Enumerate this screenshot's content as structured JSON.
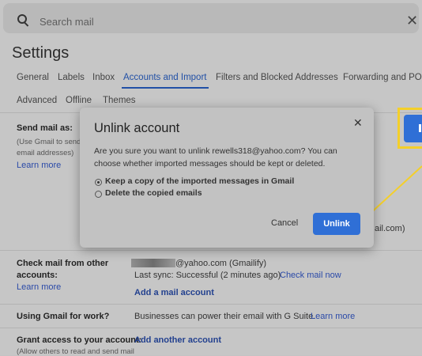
{
  "search": {
    "placeholder": "Search mail",
    "close_glyph": "✕"
  },
  "settings": {
    "title": "Settings",
    "tabs_row1": [
      "General",
      "Labels",
      "Inbox",
      "Accounts and Import",
      "Filters and Blocked Addresses",
      "Forwarding and POP"
    ],
    "tabs_row2": [
      "Advanced",
      "Offline",
      "Themes"
    ],
    "send_mail": {
      "label": "Send mail as:",
      "sub1": "(Use Gmail to send",
      "sub2": "email addresses)",
      "learn_more": "Learn more",
      "partial_text": "ail.com)"
    },
    "check_mail": {
      "label1": "Check mail from other",
      "label2": "accounts:",
      "learn_more": "Learn more",
      "account": "@yahoo.com (Gmailify)",
      "last_sync": "Last sync: Successful (2 minutes ago)",
      "check_now": "Check mail now",
      "add_account": "Add a mail account"
    },
    "work": {
      "label": "Using Gmail for work?",
      "text": "Businesses can power their email with G Suite.",
      "learn_more": "Learn more"
    },
    "grant": {
      "label": "Grant access to your account:",
      "sub": "(Allow others to read and send mail",
      "add_another": "Add another account"
    }
  },
  "modal": {
    "title": "Unlink account",
    "close_glyph": "✕",
    "body": "Are you sure you want to unlink rewells318@yahoo.com? You can choose whether imported messages should be kept or deleted.",
    "options": [
      {
        "label": "Keep a copy of the imported messages in Gmail",
        "selected": true
      },
      {
        "label": "Delete the copied emails",
        "selected": false
      }
    ],
    "cancel_label": "Cancel",
    "unlink_label": "Unlink"
  },
  "colors": {
    "accent": "#2f6fd6",
    "highlight": "#f4cf2a",
    "link": "#2b4aa8"
  },
  "icons": [
    "search-icon",
    "close-icon"
  ]
}
